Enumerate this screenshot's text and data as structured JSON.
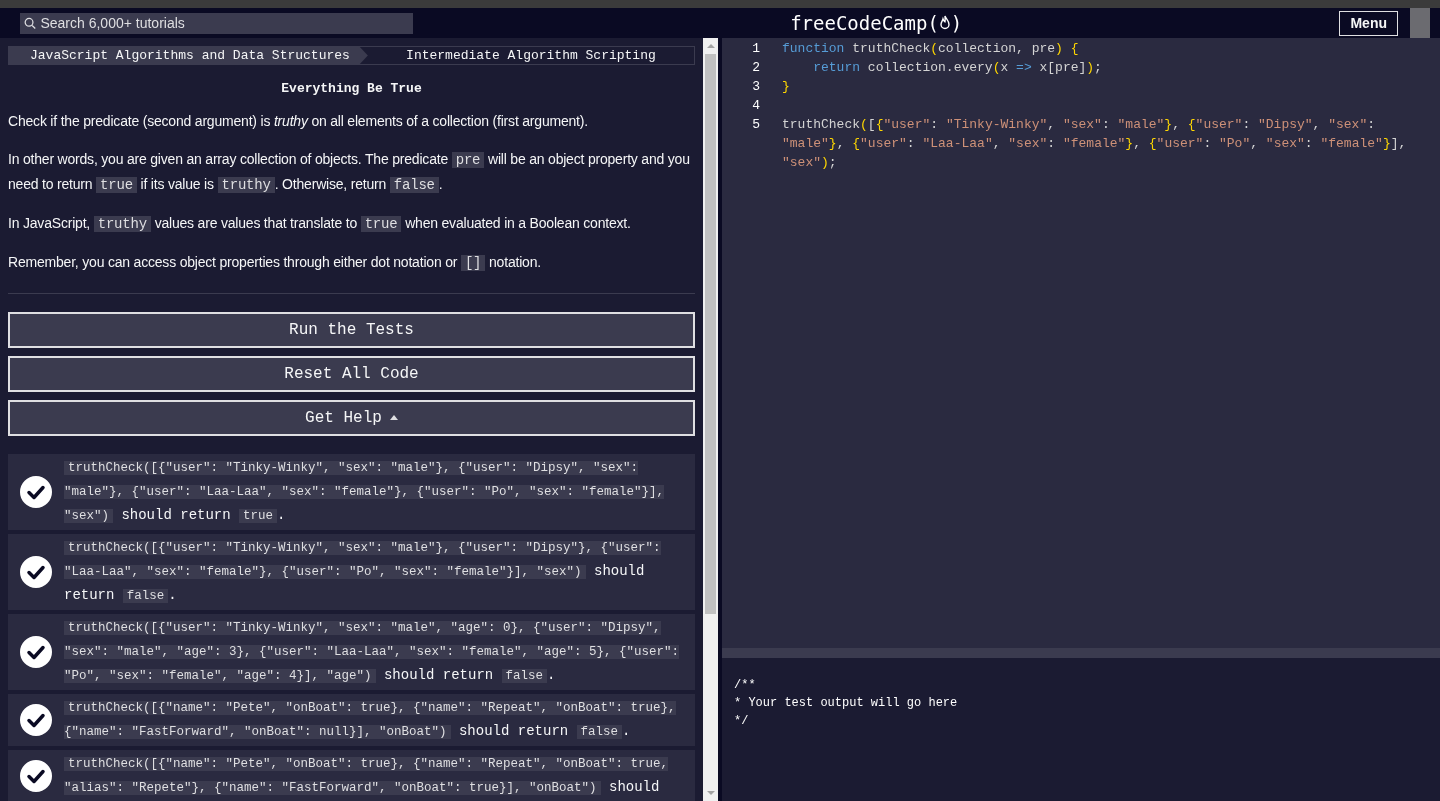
{
  "nav": {
    "search": {
      "placeholder": "Search 6,000+ tutorials"
    },
    "logo": {
      "prefix": "freeCodeCamp(",
      "suffix": ")"
    },
    "menu_button": "Menu"
  },
  "breadcrumb": [
    "JavaScript Algorithms and Data Structures",
    "Intermediate Algorithm Scripting"
  ],
  "challenge": {
    "title": "Everything Be True",
    "paragraphs": [
      [
        {
          "kind": "text",
          "text": "Check if the predicate (second argument) is *truthy* on all elements of a collection (first argument)."
        }
      ],
      [
        {
          "kind": "text",
          "text": "In other words, you are given an array collection of objects. The predicate "
        },
        {
          "kind": "code",
          "text": "pre"
        },
        {
          "kind": "text",
          "text": " will be an object property and you need to return "
        },
        {
          "kind": "code",
          "text": "true"
        },
        {
          "kind": "text",
          "text": " if its value is "
        },
        {
          "kind": "code",
          "text": "truthy"
        },
        {
          "kind": "text",
          "text": ". Otherwise, return "
        },
        {
          "kind": "code",
          "text": "false"
        },
        {
          "kind": "text",
          "text": "."
        }
      ],
      [
        {
          "kind": "text",
          "text": "In JavaScript, "
        },
        {
          "kind": "code",
          "text": "truthy"
        },
        {
          "kind": "text",
          "text": " values are values that translate to "
        },
        {
          "kind": "code",
          "text": "true"
        },
        {
          "kind": "text",
          "text": " when evaluated in a Boolean context."
        }
      ],
      [
        {
          "kind": "text",
          "text": "Remember, you can access object properties through either dot notation or "
        },
        {
          "kind": "code",
          "text": "[]"
        },
        {
          "kind": "text",
          "text": " notation."
        }
      ]
    ]
  },
  "buttons": [
    {
      "label": "Run the Tests",
      "caret": false
    },
    {
      "label": "Reset All Code",
      "caret": false
    },
    {
      "label": "Get Help",
      "caret": true
    }
  ],
  "tests": [
    {
      "passed": true,
      "parts": [
        {
          "kind": "code",
          "text": "truthCheck([{\"user\": \"Tinky-Winky\", \"sex\": \"male\"}, {\"user\": \"Dipsy\", \"sex\": \"male\"}, {\"user\": \"Laa-Laa\", \"sex\": \"female\"}, {\"user\": \"Po\", \"sex\": \"female\"}], \"sex\")"
        },
        {
          "kind": "text",
          "text": " should return "
        },
        {
          "kind": "code",
          "text": "true"
        },
        {
          "kind": "text",
          "text": "."
        }
      ]
    },
    {
      "passed": true,
      "parts": [
        {
          "kind": "code",
          "text": "truthCheck([{\"user\": \"Tinky-Winky\", \"sex\": \"male\"}, {\"user\": \"Dipsy\"}, {\"user\": \"Laa-Laa\", \"sex\": \"female\"}, {\"user\": \"Po\", \"sex\": \"female\"}], \"sex\")"
        },
        {
          "kind": "text",
          "text": " should return "
        },
        {
          "kind": "code",
          "text": "false"
        },
        {
          "kind": "text",
          "text": "."
        }
      ]
    },
    {
      "passed": true,
      "parts": [
        {
          "kind": "code",
          "text": "truthCheck([{\"user\": \"Tinky-Winky\", \"sex\": \"male\", \"age\": 0}, {\"user\": \"Dipsy\", \"sex\": \"male\", \"age\": 3}, {\"user\": \"Laa-Laa\", \"sex\": \"female\", \"age\": 5}, {\"user\": \"Po\", \"sex\": \"female\", \"age\": 4}], \"age\")"
        },
        {
          "kind": "text",
          "text": " should return "
        },
        {
          "kind": "code",
          "text": "false"
        },
        {
          "kind": "text",
          "text": "."
        }
      ]
    },
    {
      "passed": true,
      "parts": [
        {
          "kind": "code",
          "text": "truthCheck([{\"name\": \"Pete\", \"onBoat\": true}, {\"name\": \"Repeat\", \"onBoat\": true}, {\"name\": \"FastForward\", \"onBoat\": null}], \"onBoat\")"
        },
        {
          "kind": "text",
          "text": " should return "
        },
        {
          "kind": "code",
          "text": "false"
        },
        {
          "kind": "text",
          "text": "."
        }
      ]
    },
    {
      "passed": true,
      "parts": [
        {
          "kind": "code",
          "text": "truthCheck([{\"name\": \"Pete\", \"onBoat\": true}, {\"name\": \"Repeat\", \"onBoat\": true, \"alias\": \"Repete\"}, {\"name\": \"FastForward\", \"onBoat\": true}], \"onBoat\")"
        },
        {
          "kind": "text",
          "text": " should"
        }
      ]
    }
  ],
  "editor": {
    "lines": [
      {
        "number": "1",
        "tokens": [
          {
            "kind": "keyword",
            "text": "function"
          },
          {
            "kind": "plain",
            "text": " truthCheck"
          },
          {
            "kind": "bracket",
            "text": "("
          },
          {
            "kind": "plain",
            "text": "collection, pre"
          },
          {
            "kind": "bracket",
            "text": ") "
          },
          {
            "kind": "bracket",
            "text": "{"
          }
        ]
      },
      {
        "number": "2",
        "tokens": [
          {
            "kind": "keyword",
            "text": "    return"
          },
          {
            "kind": "plain",
            "text": " collection.every"
          },
          {
            "kind": "bracket",
            "text": "("
          },
          {
            "kind": "plain",
            "text": "x "
          },
          {
            "kind": "keyword",
            "text": "=>"
          },
          {
            "kind": "plain",
            "text": " x[pre]"
          },
          {
            "kind": "bracket",
            "text": ")"
          },
          {
            "kind": "plain",
            "text": ";"
          }
        ]
      },
      {
        "number": "3",
        "tokens": [
          {
            "kind": "bracket",
            "text": "}"
          }
        ]
      },
      {
        "number": "4"
      },
      {
        "number": "5",
        "tokens": [
          {
            "kind": "plain",
            "text": "truthCheck"
          },
          {
            "kind": "bracket",
            "text": "("
          },
          {
            "kind": "plain",
            "text": "["
          },
          {
            "kind": "bracket",
            "text": "{"
          },
          {
            "kind": "string",
            "text": "\"user\""
          },
          {
            "kind": "plain",
            "text": ": "
          },
          {
            "kind": "string",
            "text": "\"Tinky-Winky\""
          },
          {
            "kind": "plain",
            "text": ", "
          },
          {
            "kind": "string",
            "text": "\"sex\""
          },
          {
            "kind": "plain",
            "text": ": "
          },
          {
            "kind": "string",
            "text": "\"male\""
          },
          {
            "kind": "bracket",
            "text": "}"
          },
          {
            "kind": "plain",
            "text": ", "
          },
          {
            "kind": "bracket",
            "text": "{"
          },
          {
            "kind": "string",
            "text": "\"user\""
          },
          {
            "kind": "plain",
            "text": ": "
          },
          {
            "kind": "string",
            "text": "\"Dipsy\""
          },
          {
            "kind": "plain",
            "text": ", "
          },
          {
            "kind": "string",
            "text": "\"sex\""
          },
          {
            "kind": "plain",
            "text": ": "
          },
          {
            "kind": "string",
            "text": "\"male\""
          },
          {
            "kind": "bracket",
            "text": "}"
          },
          {
            "kind": "plain",
            "text": ", "
          },
          {
            "kind": "bracket",
            "text": "{"
          },
          {
            "kind": "string",
            "text": "\"user\""
          },
          {
            "kind": "plain",
            "text": ": "
          },
          {
            "kind": "string",
            "text": "\"Laa-Laa\""
          },
          {
            "kind": "plain",
            "text": ", "
          },
          {
            "kind": "string",
            "text": "\"sex\""
          },
          {
            "kind": "plain",
            "text": ": "
          },
          {
            "kind": "string",
            "text": "\"female\""
          },
          {
            "kind": "bracket",
            "text": "}"
          },
          {
            "kind": "plain",
            "text": ", "
          },
          {
            "kind": "bracket",
            "text": "{"
          },
          {
            "kind": "string",
            "text": "\"user\""
          },
          {
            "kind": "plain",
            "text": ": "
          },
          {
            "kind": "string",
            "text": "\"Po\""
          },
          {
            "kind": "plain",
            "text": ", "
          },
          {
            "kind": "string",
            "text": "\"sex\""
          },
          {
            "kind": "plain",
            "text": ": "
          },
          {
            "kind": "string",
            "text": "\"female\""
          },
          {
            "kind": "bracket",
            "text": "}"
          },
          {
            "kind": "plain",
            "text": "], "
          },
          {
            "kind": "string",
            "text": "\"sex\""
          },
          {
            "kind": "bracket",
            "text": ")"
          },
          {
            "kind": "plain",
            "text": ";"
          }
        ]
      }
    ]
  },
  "output": [
    "/**",
    "* Your test output will go here",
    "*/"
  ]
}
